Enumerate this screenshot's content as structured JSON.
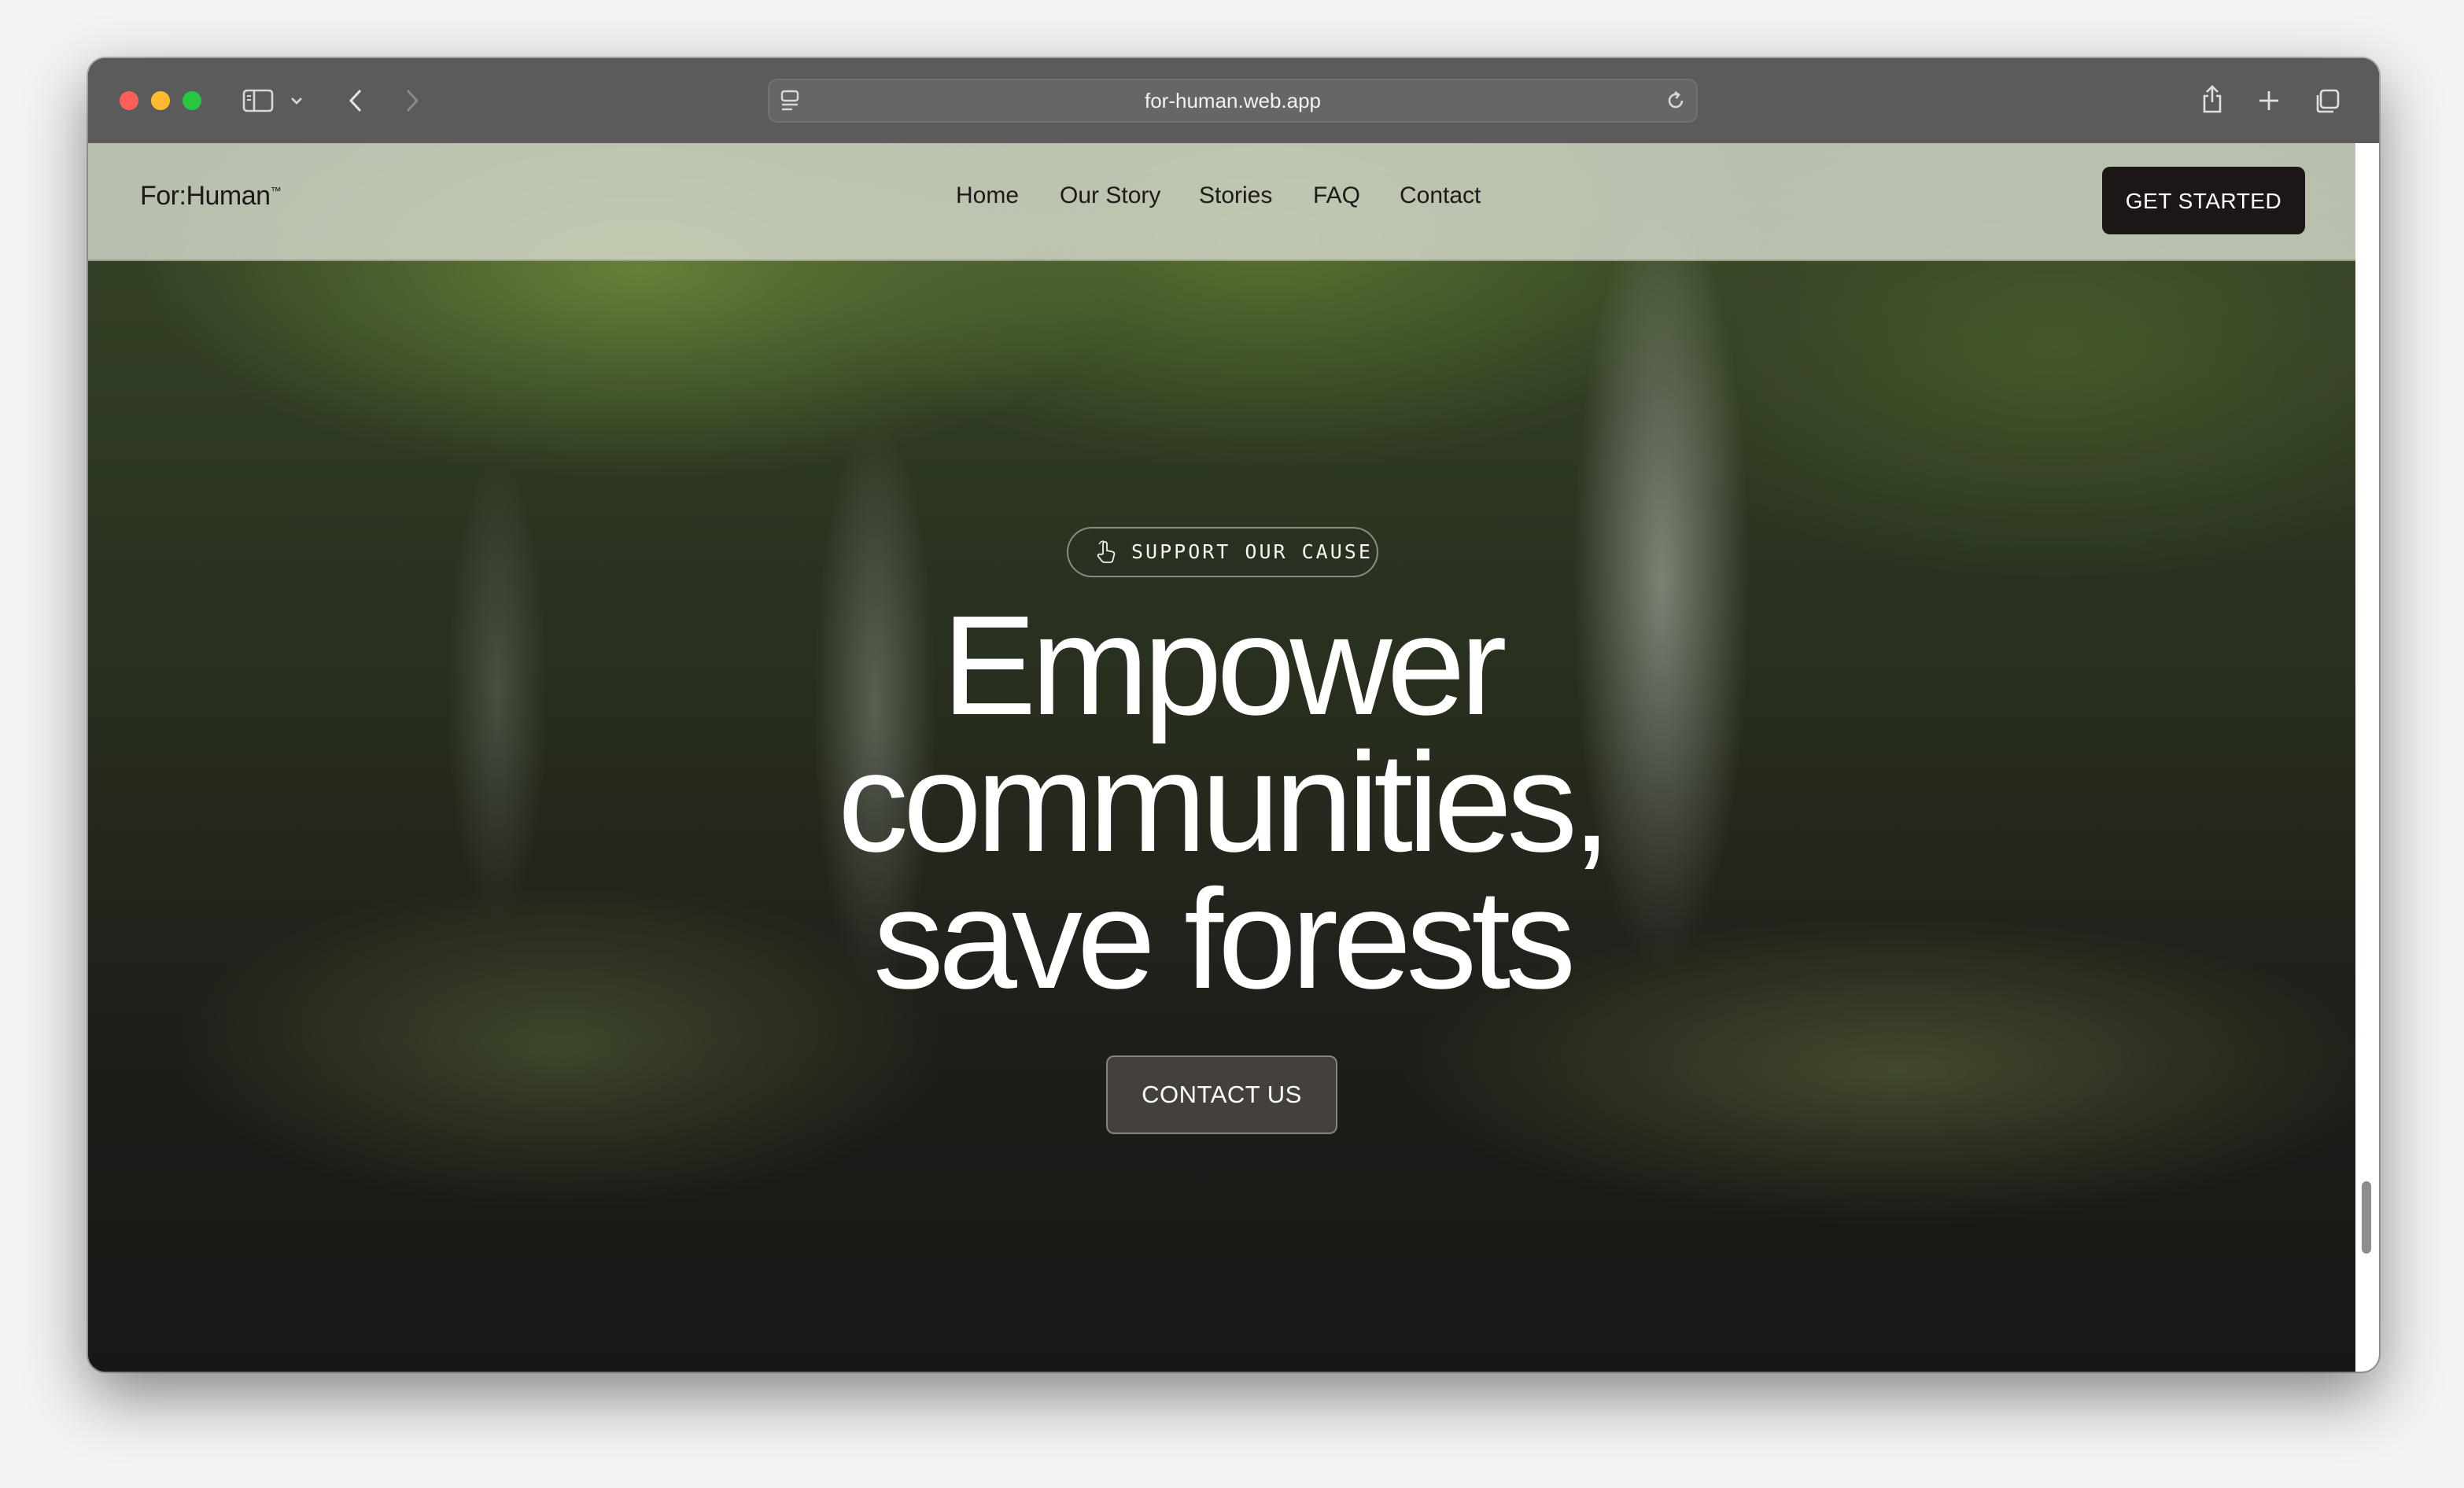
{
  "browser": {
    "url": "for-human.web.app",
    "icons": {
      "sidebar": "sidebar-icon",
      "chevron": "chevron-down-icon",
      "back": "back-arrow-icon",
      "forward": "forward-arrow-icon",
      "reader": "reader-mode-icon",
      "reload": "reload-icon",
      "share": "share-icon",
      "new_tab": "plus-icon",
      "tabs": "tabs-overview-icon"
    }
  },
  "nav": {
    "brand": "For:Human",
    "trademark": "™",
    "links": [
      "Home",
      "Our Story",
      "Stories",
      "FAQ",
      "Contact"
    ],
    "cta": "GET STARTED"
  },
  "hero": {
    "badge": "SUPPORT OUR CAUSE",
    "badge_icon": "hand-pointer-icon",
    "title_lines": [
      "Empower",
      "communities,",
      "save forests"
    ],
    "button": "CONTACT US"
  },
  "colors": {
    "cta_bg": "#1c1716",
    "chrome_bg": "#5b5b5b",
    "hero_text": "#ffffff"
  }
}
